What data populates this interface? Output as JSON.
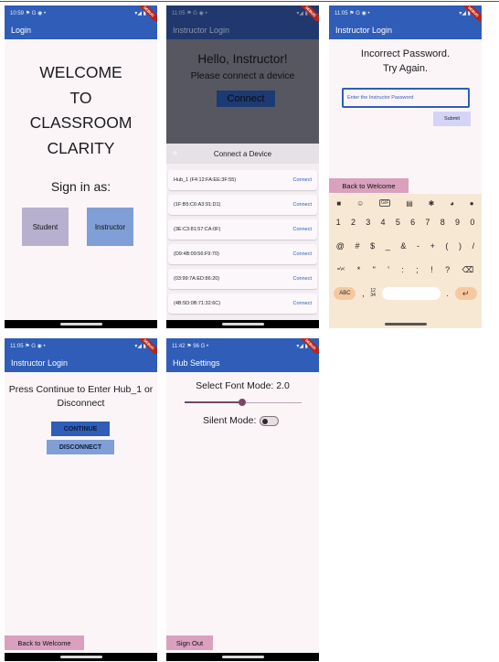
{
  "screens": {
    "login": {
      "status_time": "10:59",
      "status_icons": "⚑ G ◉ •",
      "status_right": "▾◢ ▮",
      "debug": "DEBUG",
      "title": "Login",
      "welcome_lines": [
        "WELCOME",
        "TO",
        "CLASSROOM",
        "CLARITY"
      ],
      "sign_in_as": "Sign in as:",
      "student_label": "Student",
      "instructor_label": "Instructor"
    },
    "instructor_connect": {
      "status_time": "11:05",
      "status_icons": "⚑ G ◉ •",
      "status_right": "▾◢ ▮",
      "debug": "DEBUG",
      "title": "Instructor Login",
      "hello": "Hello, Instructor!",
      "please": "Please connect a device",
      "connect_label": "Connect",
      "sheet_title": "Connect a Device",
      "devices": [
        {
          "name": "Hub_1 (F4:12:FA:EE:3F:55)",
          "action": "Connect"
        },
        {
          "name": "(1F:B5:C6:A3:91:D1)",
          "action": "Connect"
        },
        {
          "name": "(3E:C3:81:57:CA:0F)",
          "action": "Connect"
        },
        {
          "name": "(D9:4B:09:56:F9:70)",
          "action": "Connect"
        },
        {
          "name": "(03:99:7A:ED:86:20)",
          "action": "Connect"
        },
        {
          "name": "(4B:5D:0B:71:32:6C)",
          "action": "Connect"
        }
      ]
    },
    "incorrect_password": {
      "status_time": "11:05",
      "status_icons": "⚑ G ◉ •",
      "status_right": "▾◢ ▮",
      "debug": "DEBUG",
      "title": "Instructor Login",
      "message_line1": "Incorrect Password.",
      "message_line2": "Try Again.",
      "password_placeholder": "Enter the Instructor Password",
      "submit_label": "Submit",
      "back_label": "Back to Welcome",
      "keyboard": {
        "gif": "GIF",
        "row1": [
          "1",
          "2",
          "3",
          "4",
          "5",
          "6",
          "7",
          "8",
          "9",
          "0"
        ],
        "row2": [
          "@",
          "#",
          "$",
          "_",
          "&",
          "-",
          "+",
          "(",
          ")",
          "/"
        ],
        "row3": [
          "=\\<",
          "*",
          "\"",
          "'",
          ":",
          ";",
          "!",
          "?",
          "⌫"
        ],
        "abc": "ABC",
        "comma": ",",
        "num_top": "12",
        "num_bottom": "34",
        "period": ".",
        "enter": "↵",
        "hide": "⌄"
      }
    },
    "instructor_login": {
      "status_time": "11:05",
      "status_icons": "⚑ G ◉ •",
      "status_right": "▾◢ ▮",
      "debug": "DEBUG",
      "title": "Instructor Login",
      "prompt": "Press Continue to Enter Hub_1 or Disconnect",
      "continue_label": "CONTINUE",
      "disconnect_label": "DISCONNECT",
      "back_label": "Back to Welcome"
    },
    "hub_settings": {
      "status_time": "11:42",
      "status_icons": "⚑ 96 G •",
      "status_right": "▾◢ ▮",
      "debug": "DEBUG",
      "title": "Hub Settings",
      "font_mode_label": "Select Font Mode: 2.0",
      "font_mode_slider_fraction": 0.49,
      "silent_label": "Silent Mode:",
      "silent_on": false,
      "signout_label": "Sign Out"
    }
  },
  "colors": {
    "appbar": "#2f5db8",
    "background": "#fbf5f8",
    "back_button": "#d9a1bd",
    "student_button": "#b8b0cf",
    "instructor_button": "#7f9fd6",
    "keyboard": "#f7e8d4"
  }
}
